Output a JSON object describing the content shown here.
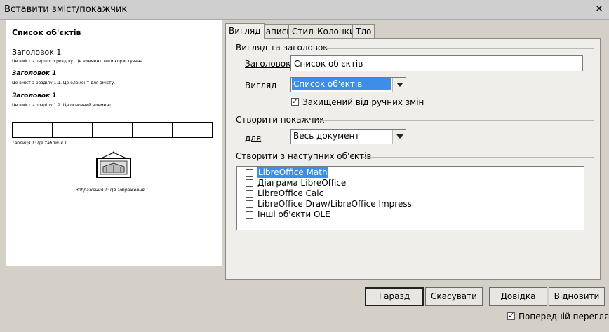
{
  "window": {
    "title": "Вставити зміст/покажчик"
  },
  "preview": {
    "title": "Список об'єктів",
    "heading1": "Заголовок 1",
    "text1": "Це вміст з першого розділу. Це елемент теки користувача.",
    "heading11": "Заголовок 1",
    "text11": "Це вміст з розділу 1.1. Це елемент для змісту.",
    "heading12": "Заголовок 1",
    "text12": "Це вміст з розділу 1.2. Це основний елемент.",
    "table_caption": "Таблиця 1: Це таблиця 1",
    "image_caption": "Зображення 1: Це зображення 1"
  },
  "tabs": [
    "Вигляд",
    "Записи",
    "Стилі",
    "Колонки",
    "Тло"
  ],
  "view": {
    "section_title": "Вигляд та заголовок",
    "title_label": "Заголовок",
    "title_value": "Список об'єктів",
    "type_label": "Вигляд",
    "type_value": "Список об'єктів",
    "protected_label": "Захищений від ручних змін",
    "protected_checked": true
  },
  "create_index": {
    "section_title": "Створити покажчик",
    "for_label": "для",
    "for_value": "Весь документ"
  },
  "create_from": {
    "section_title": "Створити з наступних об'єктів",
    "items": [
      {
        "label": "LibreOffice Math",
        "checked": false,
        "highlighted": true
      },
      {
        "label": "Діаграма LibreOffice",
        "checked": false,
        "highlighted": false
      },
      {
        "label": "LibreOffice Calc",
        "checked": false,
        "highlighted": false
      },
      {
        "label": "LibreOffice Draw/LibreOffice Impress",
        "checked": false,
        "highlighted": false
      },
      {
        "label": "Інші об'єкти OLE",
        "checked": false,
        "highlighted": false
      }
    ]
  },
  "buttons": {
    "ok": "Гаразд",
    "cancel": "Скасувати",
    "help": "Довідка",
    "reset": "Відновити"
  },
  "preview_toggle": {
    "label": "Попередній перегляд",
    "checked": true
  }
}
